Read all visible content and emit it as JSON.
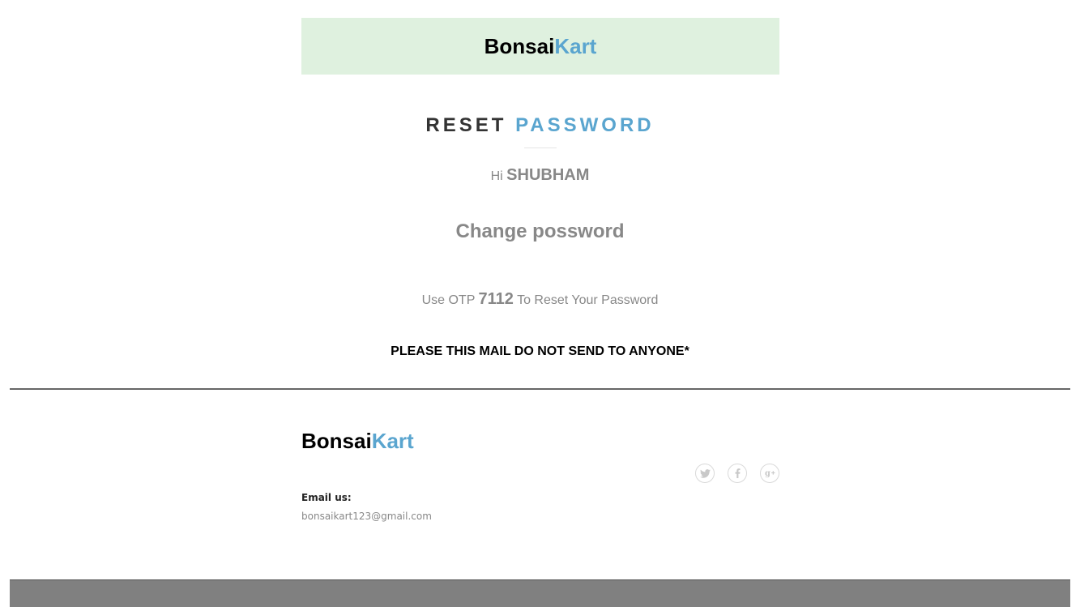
{
  "header": {
    "brand_primary": "Bonsai",
    "brand_accent": "Kart"
  },
  "main": {
    "heading_primary": "RESET",
    "heading_accent": "PASSWORD",
    "greeting_prefix": "Hi",
    "user_name": "SHUBHAM",
    "change_title": "Change possword",
    "otp_prefix": "Use OTP",
    "otp_code": "7112",
    "otp_suffix": "To Reset Your Password",
    "warning": "PLEASE THIS MAIL DO NOT SEND TO ANYONE*"
  },
  "footer": {
    "brand_primary": "Bonsai",
    "brand_accent": "Kart",
    "email_label": "Email us:",
    "email_value": "bonsaikart123@gmail.com",
    "social_icons": [
      "twitter-icon",
      "facebook-icon",
      "google-plus-icon"
    ]
  },
  "colors": {
    "accent": "#5aa5cf",
    "banner_background": "#dff1df",
    "muted_text": "#888888",
    "bottom_bar": "#808080"
  }
}
